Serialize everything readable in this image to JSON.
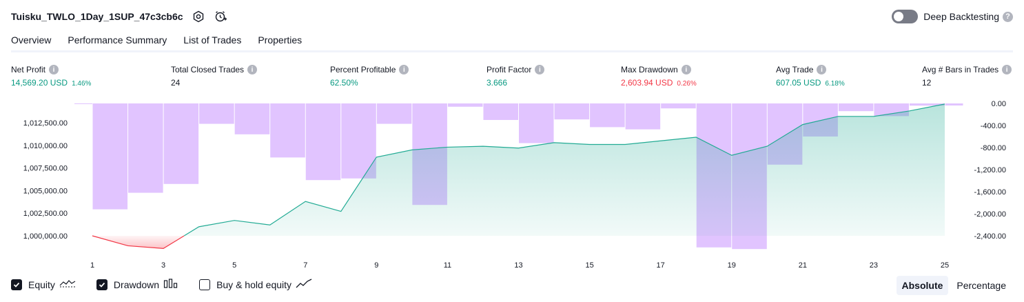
{
  "header": {
    "title": "Tuisku_TWLO_1Day_1SUP_47c3cb6c",
    "deep_label": "Deep Backtesting"
  },
  "tabs": [
    "Overview",
    "Performance Summary",
    "List of Trades",
    "Properties"
  ],
  "metrics": {
    "net_profit": {
      "label": "Net Profit",
      "value": "14,569.20 USD",
      "pct": "1.46%"
    },
    "closed_trades": {
      "label": "Total Closed Trades",
      "value": "24"
    },
    "pct_profitable": {
      "label": "Percent Profitable",
      "value": "62.50%"
    },
    "profit_factor": {
      "label": "Profit Factor",
      "value": "3.666"
    },
    "max_drawdown": {
      "label": "Max Drawdown",
      "value": "2,603.94 USD",
      "pct": "0.26%"
    },
    "avg_trade": {
      "label": "Avg Trade",
      "value": "607.05 USD",
      "pct": "6.18%"
    },
    "avg_bars": {
      "label": "Avg # Bars in Trades",
      "value": "12"
    }
  },
  "legend": {
    "equity": "Equity",
    "drawdown": "Drawdown",
    "buyhold": "Buy & hold equity"
  },
  "toggle": {
    "absolute": "Absolute",
    "percentage": "Percentage"
  },
  "colors": {
    "positive": "#089981",
    "negative": "#f23645",
    "equity_line": "#22ab94",
    "drawdown_bar": "#e1c4ff"
  },
  "chart_data": {
    "type": "line",
    "x": [
      1,
      2,
      3,
      4,
      5,
      6,
      7,
      8,
      9,
      10,
      11,
      12,
      13,
      14,
      15,
      16,
      17,
      18,
      19,
      20,
      21,
      22,
      23,
      24,
      25
    ],
    "x_ticks": [
      1,
      3,
      5,
      7,
      9,
      11,
      13,
      15,
      17,
      19,
      21,
      23,
      25
    ],
    "series": [
      {
        "axis": "left",
        "values": [
          1000000,
          998900,
          998600,
          1001000,
          1001700,
          1001200,
          1003800,
          1002700,
          1008700,
          1009500,
          1009800,
          1009900,
          1009700,
          1010300,
          1010100,
          1010100,
          1010500,
          1010900,
          1008900,
          1009900,
          1012300,
          1013200,
          1013200,
          1013800,
          1014569.2
        ]
      },
      {
        "axis": "right",
        "type": "bar",
        "values": [
          -10,
          -1920,
          -1620,
          -1460,
          -370,
          -560,
          -980,
          -1390,
          -1360,
          -370,
          -1840,
          -60,
          -300,
          -720,
          -290,
          -430,
          -470,
          -90,
          -2610,
          -2640,
          -1110,
          -600,
          -140,
          -230,
          -40
        ]
      }
    ],
    "y_left": {
      "ticks": [
        "1,000,000.00",
        "1,002,500.00",
        "1,005,000.00",
        "1,007,500.00",
        "1,010,000.00",
        "1,012,500.00"
      ],
      "range": [
        997500,
        1014800
      ]
    },
    "y_right": {
      "ticks": [
        "0.00",
        "-400.00",
        "-800.00",
        "-1,200.00",
        "-1,600.00",
        "-2,000.00",
        "-2,400.00"
      ],
      "range": [
        -2750,
        0
      ]
    }
  }
}
